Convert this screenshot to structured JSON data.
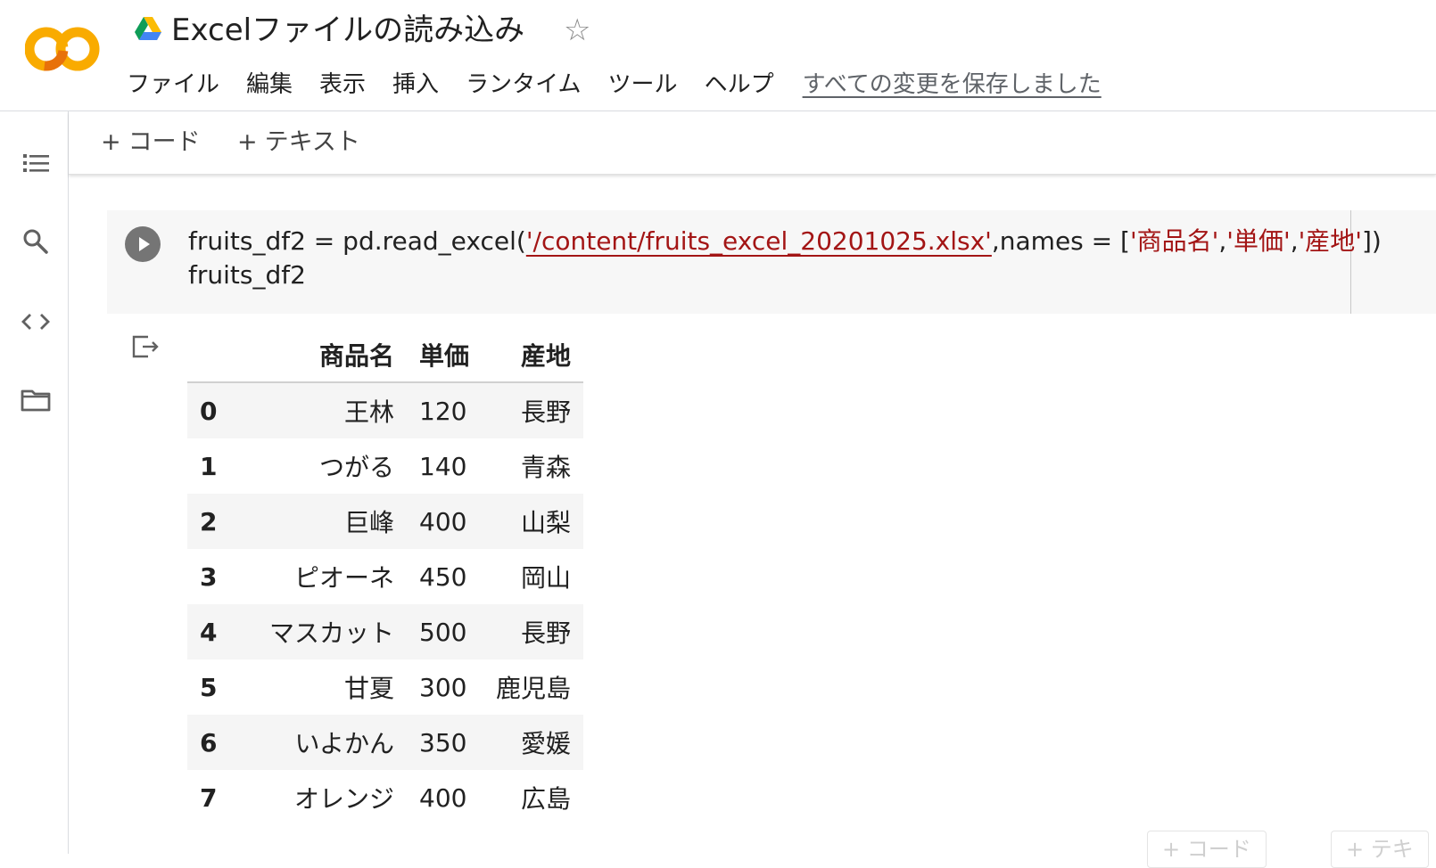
{
  "header": {
    "title": "Excelファイルの読み込み",
    "logo_text": "CO",
    "star_icon": "star-outline-icon",
    "menu": [
      "ファイル",
      "編集",
      "表示",
      "挿入",
      "ランタイム",
      "ツール",
      "ヘルプ"
    ],
    "save_status": "すべての変更を保存しました"
  },
  "rail": {
    "icons": [
      "table-of-contents-icon",
      "search-icon",
      "code-snippets-icon",
      "files-folder-icon"
    ]
  },
  "toolbar": {
    "add_code": "コード",
    "add_text": "テキスト"
  },
  "cell": {
    "code_line1_a": "fruits_df2 = pd.read_excel(",
    "code_path": "'/content/fruits_excel_20201025.xlsx'",
    "code_line1_b": ",names = [",
    "code_col1": "'商品名'",
    "code_col2": "'単価'",
    "code_col3": "'産地'",
    "code_line1_c": "])",
    "code_line2": "fruits_df2"
  },
  "output": {
    "columns": [
      "商品名",
      "単価",
      "産地"
    ],
    "rows": [
      {
        "index": "0",
        "name": "王林",
        "price": "120",
        "origin": "長野"
      },
      {
        "index": "1",
        "name": "つがる",
        "price": "140",
        "origin": "青森"
      },
      {
        "index": "2",
        "name": "巨峰",
        "price": "400",
        "origin": "山梨"
      },
      {
        "index": "3",
        "name": "ピオーネ",
        "price": "450",
        "origin": "岡山"
      },
      {
        "index": "4",
        "name": "マスカット",
        "price": "500",
        "origin": "長野"
      },
      {
        "index": "5",
        "name": "甘夏",
        "price": "300",
        "origin": "鹿児島"
      },
      {
        "index": "6",
        "name": "いよかん",
        "price": "350",
        "origin": "愛媛"
      },
      {
        "index": "7",
        "name": "オレンジ",
        "price": "400",
        "origin": "広島"
      }
    ]
  },
  "footer": {
    "ghost_code": "+ コード",
    "ghost_text": "+ テキ"
  },
  "colors": {
    "accent_orange": "#F9AB00",
    "string_red": "#A31515",
    "cell_bg": "#F7F7F7"
  }
}
